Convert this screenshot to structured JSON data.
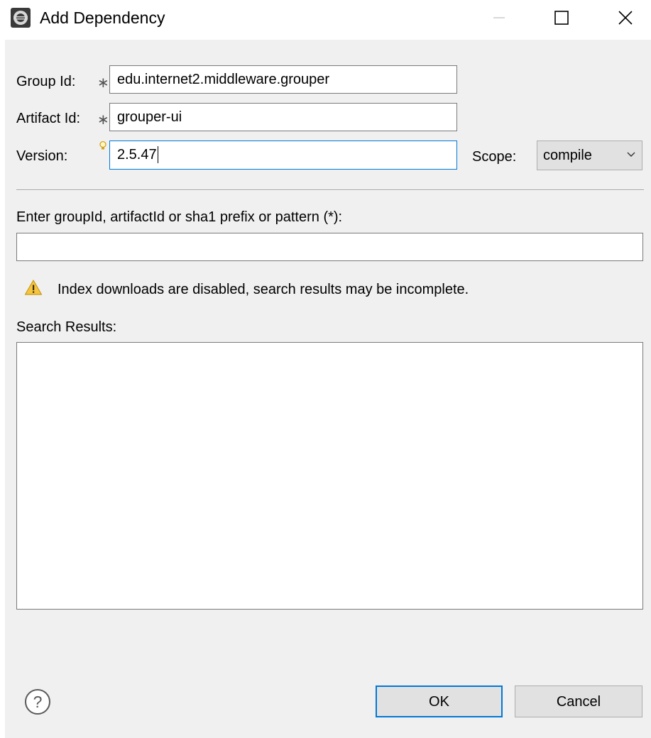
{
  "window": {
    "title": "Add Dependency",
    "icons": {
      "app": "eclipse-icon",
      "minimize": "minimize-icon",
      "maximize": "maximize-icon",
      "close": "close-icon"
    }
  },
  "form": {
    "group_id": {
      "label": "Group Id:",
      "required_marker": "∗",
      "value": "edu.internet2.middleware.grouper"
    },
    "artifact_id": {
      "label": "Artifact Id:",
      "required_marker": "∗",
      "value": "grouper-ui"
    },
    "version": {
      "label": "Version:",
      "hint_icon": "lightbulb-icon",
      "value": "2.5.47"
    },
    "scope": {
      "label": "Scope:",
      "selected": "compile"
    }
  },
  "search": {
    "prompt": "Enter groupId, artifactId or sha1 prefix or pattern (*):",
    "value": "",
    "warning": {
      "icon": "warning-icon",
      "text": "Index downloads are disabled, search results may be incomplete."
    },
    "results_label": "Search Results:",
    "results": []
  },
  "buttons": {
    "help_icon": "help-icon",
    "ok": "OK",
    "cancel": "Cancel"
  },
  "colors": {
    "dialog_bg": "#f0f0f0",
    "focus_accent": "#0078d7",
    "warning": "#f5c542"
  }
}
